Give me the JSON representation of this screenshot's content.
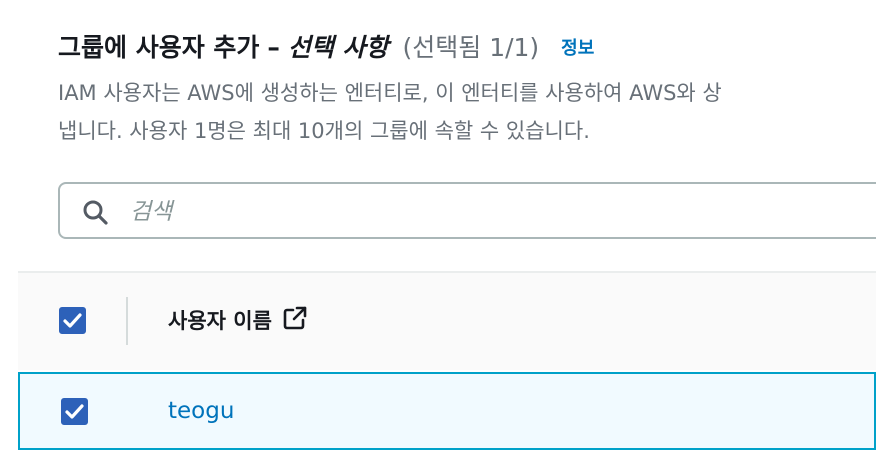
{
  "header": {
    "title": "그룹에 사용자 추가",
    "dash": "–",
    "optional": "선택 사항",
    "selection_count": "(선택됨 1/1)",
    "info_link": "정보",
    "description_line1": "IAM 사용자는 AWS에 생성하는 엔터티로, 이 엔터티를 사용하여 AWS와 상",
    "description_line2": "냅니다. 사용자 1명은 최대 10개의 그룹에 속할 수 있습니다."
  },
  "search": {
    "placeholder": "검색",
    "value": ""
  },
  "table": {
    "columns": [
      {
        "label": "사용자 이름",
        "icon": "external-link-icon"
      }
    ],
    "header_checkbox_checked": true,
    "rows": [
      {
        "username": "teogu",
        "checked": true
      }
    ]
  },
  "colors": {
    "link": "#0073bb",
    "checkbox": "#2d61b9",
    "selected_row_bg": "#f1faff",
    "selected_row_border": "#00a1c9",
    "muted_text": "#687078"
  }
}
